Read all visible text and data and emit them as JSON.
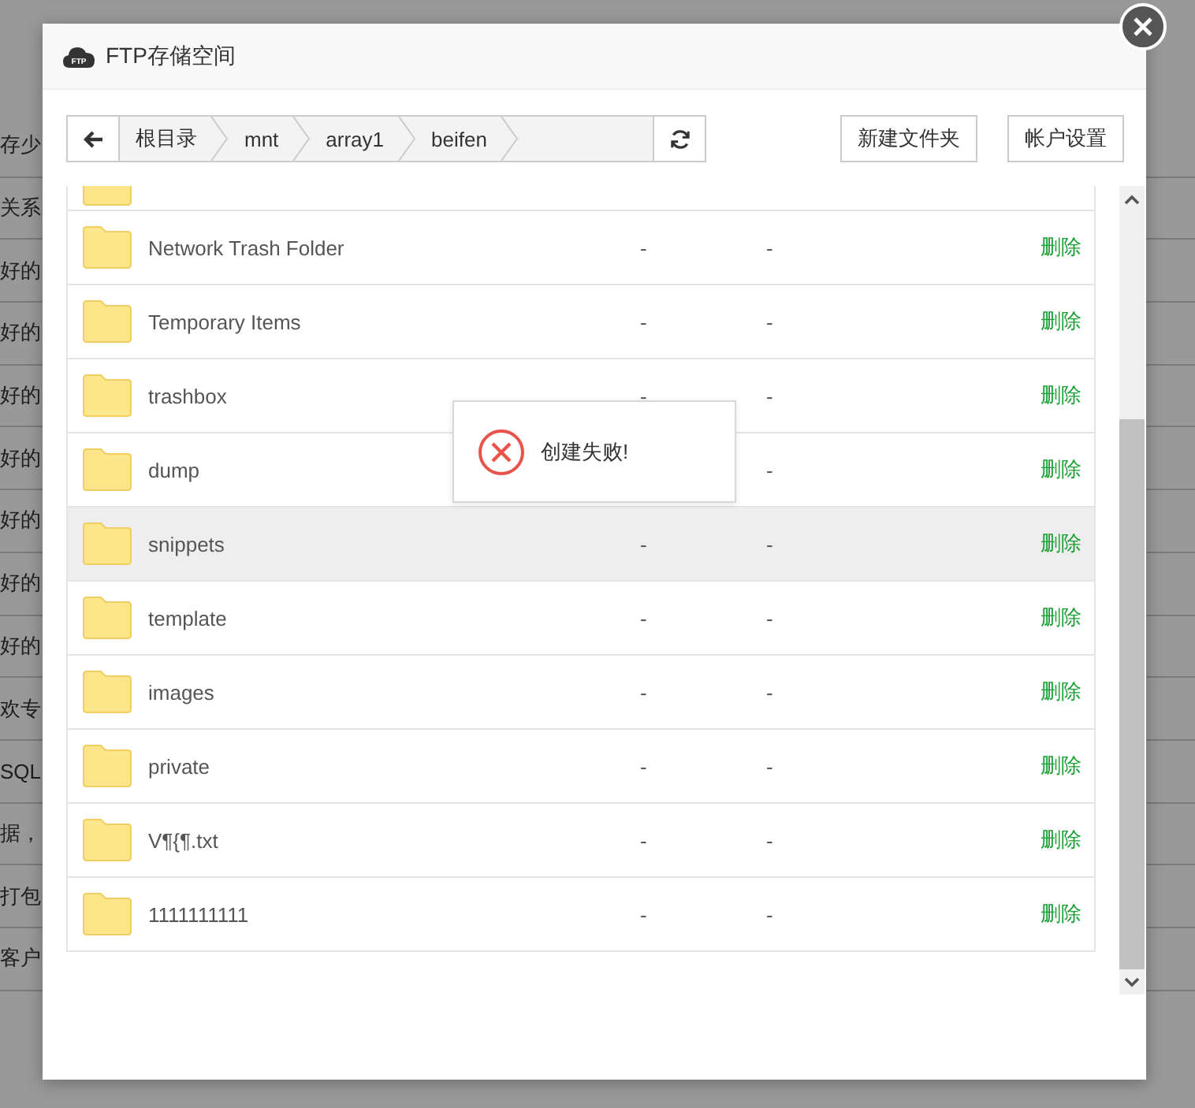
{
  "background_page": {
    "row_texts": [
      "存少",
      "关系",
      "好的",
      "好的",
      "好的",
      "好的",
      "好的",
      "好的",
      "好的",
      "欢专",
      "SQL",
      "据，",
      "打包",
      "客户"
    ]
  },
  "dialog": {
    "title": "FTP存储空间",
    "logo_text": "FTP",
    "breadcrumb": [
      "根目录",
      "mnt",
      "array1",
      "beifen"
    ],
    "buttons": [
      "新建文件夹",
      "帐户设置"
    ],
    "files": [
      {
        "name": "Network Trash Folder",
        "size": "-",
        "time": "-",
        "action": "删除",
        "hovered": false
      },
      {
        "name": "Temporary Items",
        "size": "-",
        "time": "-",
        "action": "删除",
        "hovered": false
      },
      {
        "name": "trashbox",
        "size": "-",
        "time": "-",
        "action": "删除",
        "hovered": false
      },
      {
        "name": "dump",
        "time": "-",
        "action": "删除",
        "hovered": false
      },
      {
        "name": "snippets",
        "size": "-",
        "time": "-",
        "action": "删除",
        "hovered": true
      },
      {
        "name": "template",
        "size": "-",
        "time": "-",
        "action": "删除",
        "hovered": false
      },
      {
        "name": "images",
        "size": "-",
        "time": "-",
        "action": "删除",
        "hovered": false
      },
      {
        "name": "private",
        "size": "-",
        "time": "-",
        "action": "删除",
        "hovered": false
      },
      {
        "name": "V¶{¶.txt",
        "size": "-",
        "time": "-",
        "action": "删除",
        "hovered": false
      },
      {
        "name": "1111111111",
        "size": "-",
        "time": "-",
        "action": "删除",
        "hovered": false
      }
    ],
    "toast": {
      "kind": "error",
      "message": "创建失败!"
    }
  }
}
